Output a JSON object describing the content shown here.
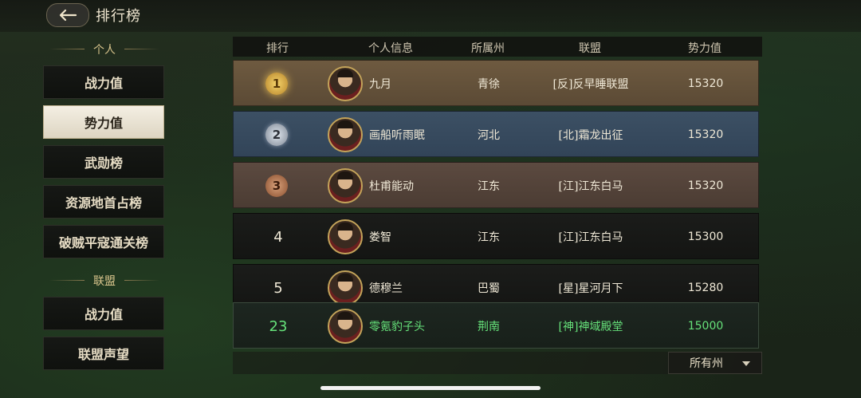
{
  "header": {
    "title": "排行榜"
  },
  "sidebar": {
    "personal_label": "个人",
    "personal_items": [
      {
        "label": "战力值",
        "active": false
      },
      {
        "label": "势力值",
        "active": true
      },
      {
        "label": "武勋榜",
        "active": false
      },
      {
        "label": "资源地首占榜",
        "active": false
      },
      {
        "label": "破贼平寇通关榜",
        "active": false
      }
    ],
    "alliance_label": "联盟",
    "alliance_items": [
      {
        "label": "战力值",
        "active": false
      },
      {
        "label": "联盟声望",
        "active": false
      }
    ]
  },
  "table": {
    "columns": [
      "排行",
      "个人信息",
      "所属州",
      "联盟",
      "势力值"
    ],
    "rows": [
      {
        "rank": "1",
        "name": "九月",
        "state": "青徐",
        "alliance": "[反]反早睡联盟",
        "power": "15320"
      },
      {
        "rank": "2",
        "name": "画船听雨眠",
        "state": "河北",
        "alliance": "[北]霜龙出征",
        "power": "15320"
      },
      {
        "rank": "3",
        "name": "杜甫能动",
        "state": "江东",
        "alliance": "[江]江东白马",
        "power": "15320"
      },
      {
        "rank": "4",
        "name": "娄智",
        "state": "江东",
        "alliance": "[江]江东白马",
        "power": "15300"
      },
      {
        "rank": "5",
        "name": "德穆兰",
        "state": "巴蜀",
        "alliance": "[星]星河月下",
        "power": "15280"
      }
    ],
    "self_row": {
      "rank": "23",
      "name": "零氪豹子头",
      "state": "荆南",
      "alliance": "[神]神域殿堂",
      "power": "15000"
    }
  },
  "filter": {
    "selected": "所有州"
  },
  "colors": {
    "self_highlight": "#66e27a",
    "gold": "#f5d36a",
    "accent": "#d8c48c"
  }
}
